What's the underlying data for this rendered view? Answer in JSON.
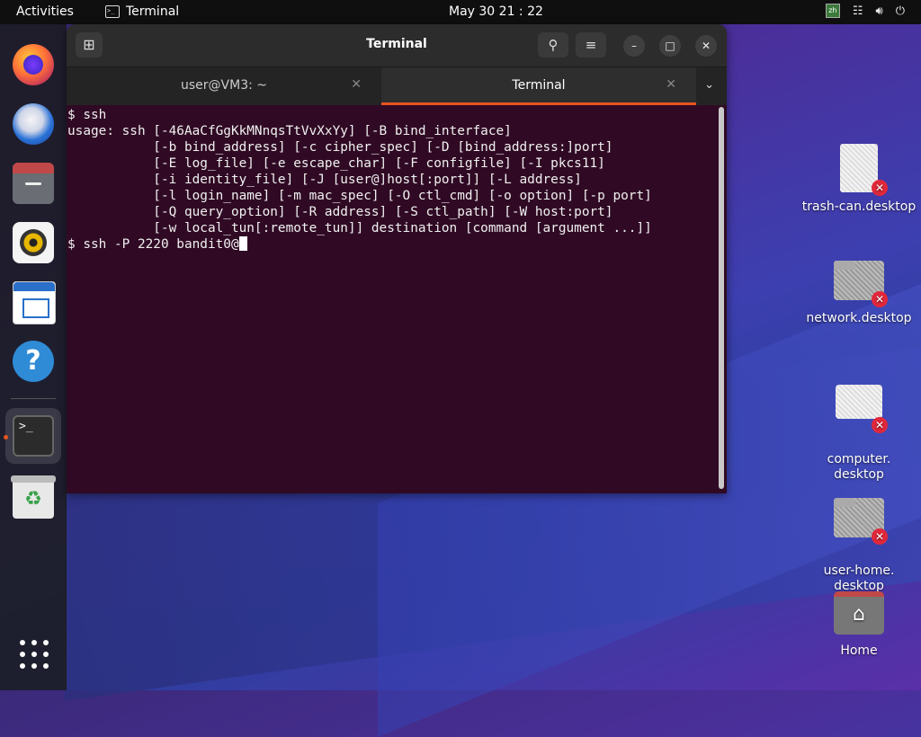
{
  "topbar": {
    "activities": "Activities",
    "app_name": "Terminal",
    "clock": "May 30  21 : 22"
  },
  "dock": {
    "items": [
      {
        "name": "firefox-icon"
      },
      {
        "name": "thunderbird-icon"
      },
      {
        "name": "files-icon"
      },
      {
        "name": "rhythmbox-icon"
      },
      {
        "name": "libreoffice-writer-icon"
      },
      {
        "name": "help-icon",
        "glyph": "?"
      },
      {
        "name": "terminal-icon",
        "glyph": ">_"
      },
      {
        "name": "trash-icon"
      }
    ]
  },
  "window": {
    "title": "Terminal",
    "tabs": [
      {
        "label": "user@VM3: ~",
        "active": false
      },
      {
        "label": "Terminal",
        "active": true
      }
    ],
    "lines": [
      "$ ssh",
      "usage: ssh [-46AaCfGgKkMNnqsTtVvXxYy] [-B bind_interface]",
      "           [-b bind_address] [-c cipher_spec] [-D [bind_address:]port]",
      "           [-E log_file] [-e escape_char] [-F configfile] [-I pkcs11]",
      "           [-i identity_file] [-J [user@]host[:port]] [-L address]",
      "           [-l login_name] [-m mac_spec] [-O ctl_cmd] [-o option] [-p port]",
      "           [-Q query_option] [-R address] [-S ctl_path] [-W host:port]",
      "           [-w local_tun[:remote_tun]] destination [command [argument ...]]"
    ],
    "prompt_line": "$ ssh -P 2220 bandit0@"
  },
  "desktop": {
    "icons": [
      {
        "label": "trash-can.desktop"
      },
      {
        "label": "network.desktop"
      },
      {
        "label": "computer.\ndesktop"
      },
      {
        "label": "user-home.\ndesktop"
      },
      {
        "label": "Home"
      }
    ]
  },
  "colors": {
    "terminal_bg": "#300a24",
    "accent": "#e95420"
  }
}
